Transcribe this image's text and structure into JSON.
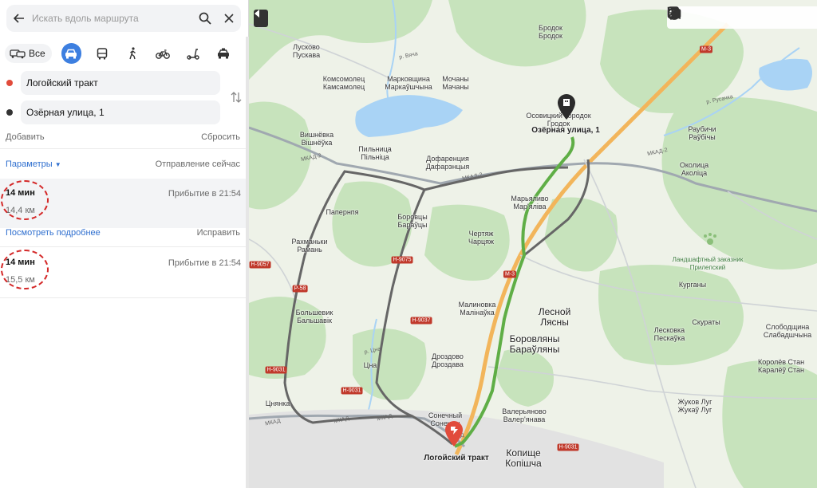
{
  "search": {
    "placeholder": "Искать вдоль маршрута"
  },
  "modes": {
    "all_label": "Все"
  },
  "points": {
    "from": "Логойский тракт",
    "to": "Озёрная улица, 1"
  },
  "actions": {
    "add": "Добавить",
    "reset": "Сбросить"
  },
  "params": {
    "label": "Параметры",
    "departure": "Отправление сейчас"
  },
  "routes": [
    {
      "time": "14 мин",
      "distance": "14,4 км",
      "arrival": "Прибытие в 21:54"
    },
    {
      "time": "14 мин",
      "distance": "15,5 км",
      "arrival": "Прибытие в 21:54"
    }
  ],
  "route_links": {
    "details": "Посмотреть подробнее",
    "fix": "Исправить"
  },
  "colors": {
    "accent": "#3d7fe0",
    "route_active": "#5fae46",
    "route_alt": "#666666",
    "start": "#e14b3b",
    "end": "#333333",
    "forest": "#c7e3bc",
    "field": "#eef2e8",
    "water": "#a9d3f5"
  },
  "map": {
    "places": [
      {
        "name": "Бродок",
        "alt": "Бродок"
      },
      {
        "name": "Лусково",
        "alt": "Пускава"
      },
      {
        "name": "Комсомолец",
        "alt": "Камсамолец"
      },
      {
        "name": "Марковщина",
        "alt": "Маркаўшчына"
      },
      {
        "name": "Мочаны",
        "alt": "Мачаны"
      },
      {
        "name": "Осовицкий Городок",
        "alt": "Гродок"
      },
      {
        "name": "Вишнёвка",
        "alt": "Вішнёўка"
      },
      {
        "name": "Пильница",
        "alt": "Пільніца"
      },
      {
        "name": "Дофаренция",
        "alt": "Дафарэнцыя"
      },
      {
        "name": "Раубичи",
        "alt": "Раўбічы"
      },
      {
        "name": "Околица",
        "alt": "Аколіца"
      },
      {
        "name": "Марьяливо",
        "alt": "Мар'яліва"
      },
      {
        "name": "Папернпя",
        "alt": ""
      },
      {
        "name": "Боровцы",
        "alt": "Бараўцы"
      },
      {
        "name": "Чертяж",
        "alt": "Чарцяж"
      },
      {
        "name": "Рахманьки",
        "alt": "Рамань"
      },
      {
        "name": "Курганы",
        "alt": ""
      },
      {
        "name": "Малиновка",
        "alt": "Малінаўка"
      },
      {
        "name": "Большевик",
        "alt": "Бальшавік"
      },
      {
        "name": "Лесковка",
        "alt": "Пескаўка"
      },
      {
        "name": "Скураты",
        "alt": ""
      },
      {
        "name": "Слободщина",
        "alt": "Слабадшчына"
      },
      {
        "name": "Дроздово",
        "alt": "Дроздава"
      },
      {
        "name": "Цна",
        "alt": ""
      },
      {
        "name": "Королёв Стан",
        "alt": "Каралёў Стан"
      },
      {
        "name": "Цнянка",
        "alt": ""
      },
      {
        "name": "Сонечный",
        "alt": "Сонечны"
      },
      {
        "name": "Валерьяново",
        "alt": "Валер'янава"
      },
      {
        "name": "Жуков Луг",
        "alt": "Жукаў Луг"
      }
    ],
    "big_places": [
      {
        "name": "Лесной",
        "alt": "Лясны"
      },
      {
        "name": "Боровляны",
        "alt": "Бараўляны"
      },
      {
        "name": "Копище",
        "alt": "Копішча"
      }
    ],
    "destination_label": "Озёрная улица, 1",
    "start_label": "Логойский тракт",
    "park_label": "Ландшафтный заказник Прилепский",
    "road_labels": [
      "М-3",
      "М-3",
      "Н-9075",
      "Р-58",
      "Н-9037",
      "Н-9031",
      "Н-9031",
      "Н-9031",
      "Н-9057"
    ],
    "mkad_labels": [
      "МКАД-2",
      "МКАД-2",
      "МКАД-2",
      "МКАД",
      "МКАД",
      "МКАД",
      "МКАД"
    ],
    "river_labels": [
      "р. Вяча",
      "р. Цна",
      "р. Русачка"
    ]
  }
}
